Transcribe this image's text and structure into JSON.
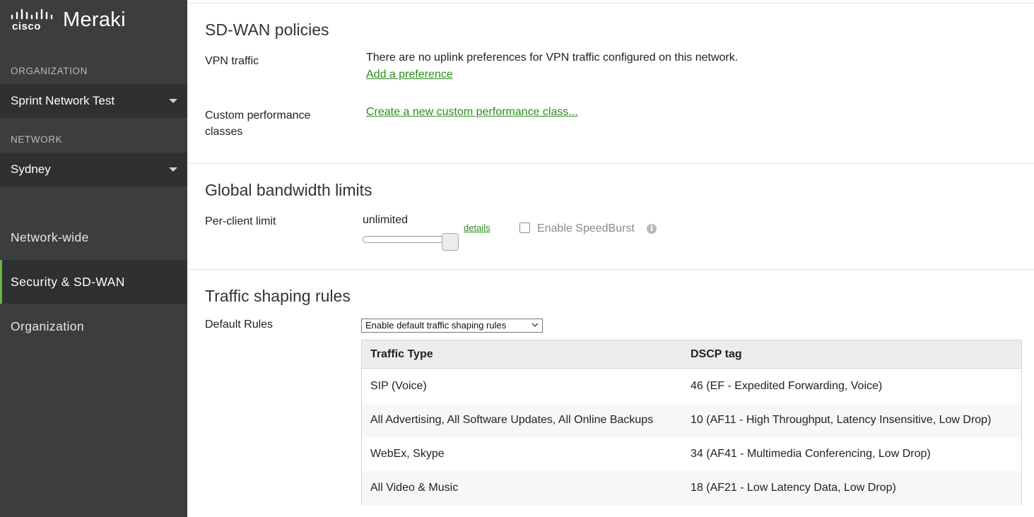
{
  "brand": {
    "company": "cisco",
    "product": "Meraki"
  },
  "sidebar": {
    "org_label": "ORGANIZATION",
    "org_value": "Sprint Network Test",
    "net_label": "NETWORK",
    "net_value": "Sydney",
    "nav": [
      {
        "label": "Network-wide",
        "active": false
      },
      {
        "label": "Security & SD-WAN",
        "active": true
      },
      {
        "label": "Organization",
        "active": false
      }
    ]
  },
  "sdwan": {
    "title": "SD-WAN policies",
    "vpn_label": "VPN traffic",
    "vpn_text": "There are no uplink preferences for VPN traffic configured on this network.",
    "vpn_link": "Add a preference",
    "custom_label_1": "Custom performance",
    "custom_label_2": "classes",
    "custom_link": "Create a new custom performance class..."
  },
  "bandwidth": {
    "title": "Global bandwidth limits",
    "client_label": "Per-client limit",
    "limit_value": "unlimited",
    "details_link": "details",
    "speedburst_label": "Enable SpeedBurst",
    "speedburst_checked": false,
    "slider_position_percent": 100
  },
  "shaping": {
    "title": "Traffic shaping rules",
    "default_label": "Default Rules",
    "select_value": "Enable default traffic shaping rules",
    "columns": [
      "Traffic Type",
      "DSCP tag"
    ],
    "rows": [
      {
        "type": "SIP (Voice)",
        "dscp": "46 (EF - Expedited Forwarding, Voice)"
      },
      {
        "type": "All Advertising, All Software Updates, All Online Backups",
        "dscp": "10 (AF11 - High Throughput, Latency Insensitive, Low Drop)"
      },
      {
        "type": "WebEx, Skype",
        "dscp": "34 (AF41 - Multimedia Conferencing, Low Drop)"
      },
      {
        "type": "All Video & Music",
        "dscp": "18 (AF21 - Low Latency Data, Low Drop)"
      }
    ]
  },
  "colors": {
    "sidebar": "#3b3d3f",
    "sidebar_active": "#2e3032",
    "accent": "#67b346",
    "link": "#2e8b1f"
  }
}
